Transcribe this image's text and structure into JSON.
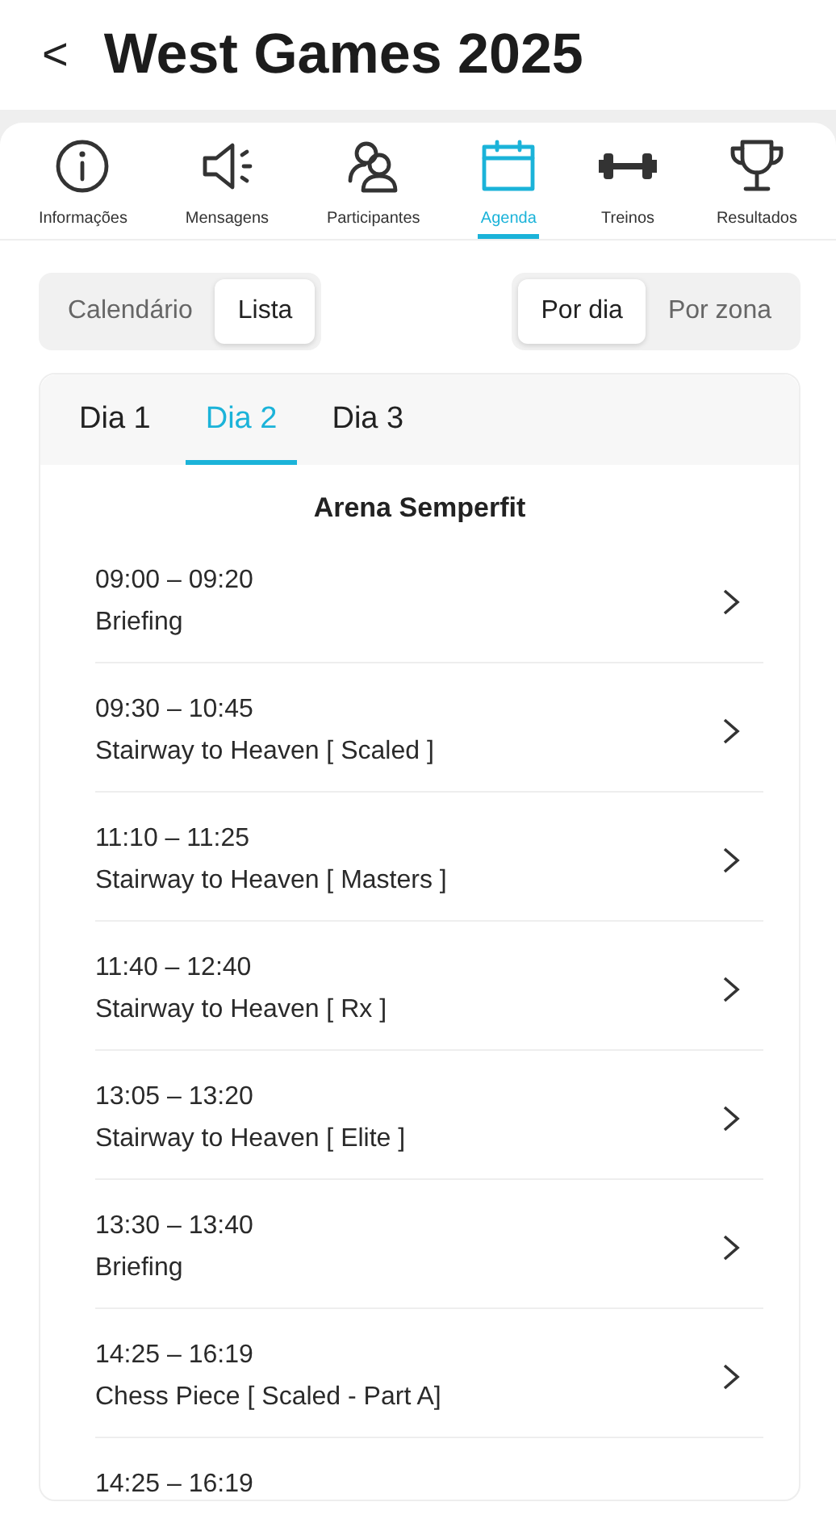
{
  "header": {
    "back": "<",
    "title": "West Games 2025"
  },
  "nav_tabs": [
    {
      "label": "Informações",
      "selected": false
    },
    {
      "label": "Mensagens",
      "selected": false
    },
    {
      "label": "Participantes",
      "selected": false
    },
    {
      "label": "Agenda",
      "selected": true
    },
    {
      "label": "Treinos",
      "selected": false
    },
    {
      "label": "Resultados",
      "selected": false
    }
  ],
  "view_toggle": [
    {
      "label": "Calendário",
      "selected": false
    },
    {
      "label": "Lista",
      "selected": true
    }
  ],
  "group_toggle": [
    {
      "label": "Por dia",
      "selected": true
    },
    {
      "label": "Por zona",
      "selected": false
    }
  ],
  "day_tabs": [
    {
      "label": "Dia 1",
      "selected": false
    },
    {
      "label": "Dia 2",
      "selected": true
    },
    {
      "label": "Dia 3",
      "selected": false
    }
  ],
  "zone": "Arena Semperfit",
  "events": [
    {
      "time": "09:00 – 09:20",
      "title": "Briefing"
    },
    {
      "time": "09:30 – 10:45",
      "title": "Stairway to Heaven [ Scaled ]"
    },
    {
      "time": "11:10 – 11:25",
      "title": "Stairway to Heaven [ Masters ]"
    },
    {
      "time": "11:40 – 12:40",
      "title": "Stairway to Heaven [ Rx ]"
    },
    {
      "time": "13:05 – 13:20",
      "title": "Stairway to Heaven [ Elite ]"
    },
    {
      "time": "13:30 – 13:40",
      "title": "Briefing"
    },
    {
      "time": "14:25 – 16:19",
      "title": "Chess Piece [ Scaled - Part A]"
    },
    {
      "time": "14:25 – 16:19"
    }
  ]
}
